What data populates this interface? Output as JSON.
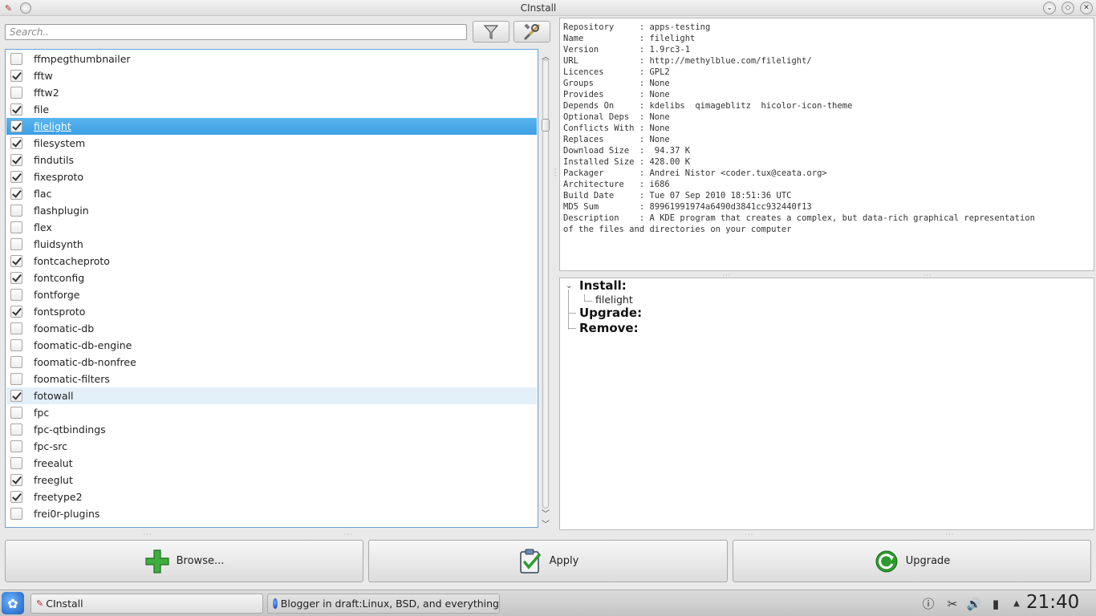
{
  "window": {
    "title": "CInstall"
  },
  "search": {
    "placeholder": "Search.."
  },
  "packages": [
    {
      "name": "ffmpegthumbnailer",
      "checked": false
    },
    {
      "name": "fftw",
      "checked": true
    },
    {
      "name": "fftw2",
      "checked": false
    },
    {
      "name": "file",
      "checked": true
    },
    {
      "name": "filelight",
      "checked": true,
      "selected": true
    },
    {
      "name": "filesystem",
      "checked": true
    },
    {
      "name": "findutils",
      "checked": true
    },
    {
      "name": "fixesproto",
      "checked": true
    },
    {
      "name": "flac",
      "checked": true
    },
    {
      "name": "flashplugin",
      "checked": false
    },
    {
      "name": "flex",
      "checked": false
    },
    {
      "name": "fluidsynth",
      "checked": false
    },
    {
      "name": "fontcacheproto",
      "checked": true
    },
    {
      "name": "fontconfig",
      "checked": true
    },
    {
      "name": "fontforge",
      "checked": false
    },
    {
      "name": "fontsproto",
      "checked": true
    },
    {
      "name": "foomatic-db",
      "checked": false
    },
    {
      "name": "foomatic-db-engine",
      "checked": false
    },
    {
      "name": "foomatic-db-nonfree",
      "checked": false
    },
    {
      "name": "foomatic-filters",
      "checked": false
    },
    {
      "name": "fotowall",
      "checked": true,
      "hover": true
    },
    {
      "name": "fpc",
      "checked": false
    },
    {
      "name": "fpc-qtbindings",
      "checked": false
    },
    {
      "name": "fpc-src",
      "checked": false
    },
    {
      "name": "freealut",
      "checked": false
    },
    {
      "name": "freeglut",
      "checked": true
    },
    {
      "name": "freetype2",
      "checked": true
    },
    {
      "name": "frei0r-plugins",
      "checked": false
    }
  ],
  "info": {
    "lines": [
      "Repository     : apps-testing",
      "Name           : filelight",
      "Version        : 1.9rc3-1",
      "URL            : http://methylblue.com/filelight/",
      "Licences       : GPL2",
      "Groups         : None",
      "Provides       : None",
      "Depends On     : kdelibs  qimageblitz  hicolor-icon-theme",
      "Optional Deps  : None",
      "Conflicts With : None",
      "Replaces       : None",
      "Download Size  :  94.37 K",
      "Installed Size : 428.00 K",
      "Packager       : Andrei Nistor <coder.tux@ceata.org>",
      "Architecture   : i686",
      "Build Date     : Tue 07 Sep 2010 18:51:36 UTC",
      "MD5 Sum        : 89961991974a6490d3841cc932440f13",
      "Description    : A KDE program that creates a complex, but data-rich graphical representation",
      "of the files and directories on your computer"
    ]
  },
  "queue": {
    "install_label": "Install:",
    "install_items": [
      "filelight"
    ],
    "upgrade_label": "Upgrade:",
    "remove_label": "Remove:"
  },
  "buttons": {
    "browse": "Browse...",
    "apply": "Apply",
    "upgrade": "Upgrade"
  },
  "taskbar": {
    "tasks": [
      "CInstall",
      "Blogger in draft:Linux, BSD, and everything"
    ],
    "clock": "21:40"
  },
  "colors": {
    "selection": "#3c9fe2",
    "hover": "#e3eff9",
    "install_icon": "#2e9b2e"
  }
}
